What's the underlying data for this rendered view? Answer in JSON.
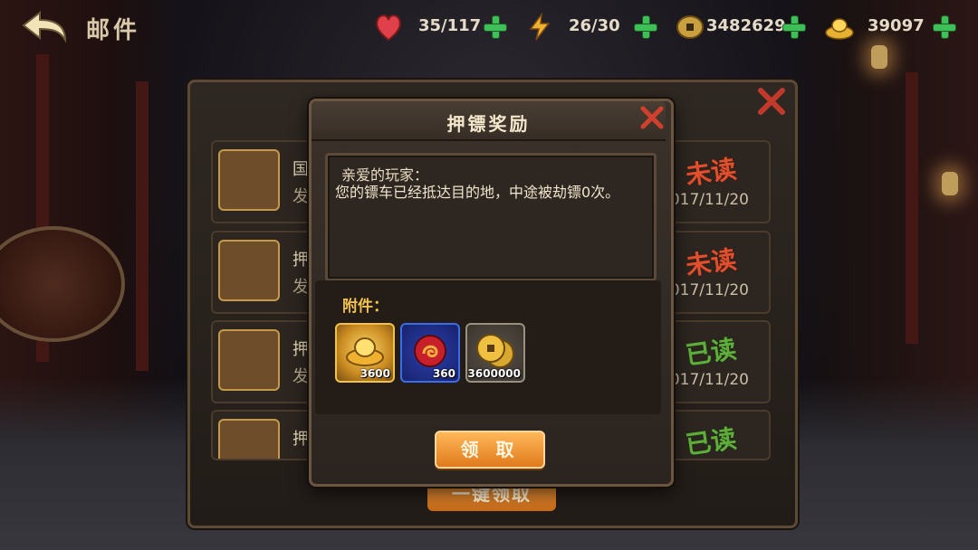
{
  "header": {
    "title": "邮件"
  },
  "resources": {
    "stamina": "35/117",
    "energy": "26/30",
    "coins": "3482629",
    "ingots": "39097"
  },
  "mail_list": {
    "header_title": "邮件",
    "rows": [
      {
        "title": "国",
        "sender": "发",
        "status": "未读",
        "date": "2017/11/20"
      },
      {
        "title": "押",
        "sender": "发",
        "status": "未读",
        "date": "2017/11/20"
      },
      {
        "title": "押",
        "sender": "发",
        "status": "已读",
        "date": "2017/11/20"
      },
      {
        "title": "押",
        "sender": "发",
        "status": "已读",
        "date": ""
      }
    ],
    "claim_all_label": "一键领取"
  },
  "popup": {
    "title": "押镖奖励",
    "greeting": "亲爱的玩家：",
    "body": "您的镖车已经抵达目的地，中途被劫镖0次。",
    "attachments_label": "附件：",
    "attachments": [
      {
        "icon": "gold-ingot-icon",
        "count": "3600"
      },
      {
        "icon": "red-orb-icon",
        "count": "360"
      },
      {
        "icon": "copper-coin-icon",
        "count": "3600000"
      }
    ],
    "claim_label": "领 取"
  },
  "colors": {
    "unread": "#e0502e",
    "read": "#5fae3c",
    "accent_orange": "#e07a1c",
    "attach_label": "#f2c24a"
  }
}
